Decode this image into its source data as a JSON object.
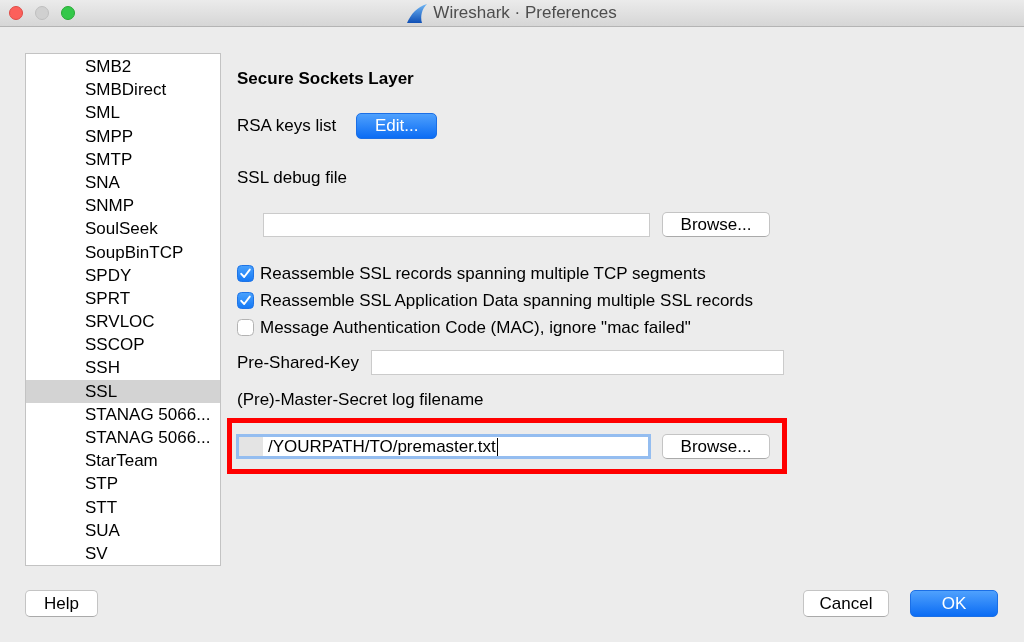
{
  "window": {
    "title": "Wireshark · Preferences",
    "controls": [
      {
        "kind": "close",
        "disabled": false
      },
      {
        "kind": "minimize",
        "disabled": true
      },
      {
        "kind": "zoom",
        "disabled": false
      }
    ]
  },
  "sidebar": {
    "items": [
      {
        "label": "SMB2",
        "selected": false
      },
      {
        "label": "SMBDirect",
        "selected": false
      },
      {
        "label": "SML",
        "selected": false
      },
      {
        "label": "SMPP",
        "selected": false
      },
      {
        "label": "SMTP",
        "selected": false
      },
      {
        "label": "SNA",
        "selected": false
      },
      {
        "label": "SNMP",
        "selected": false
      },
      {
        "label": "SoulSeek",
        "selected": false
      },
      {
        "label": "SoupBinTCP",
        "selected": false
      },
      {
        "label": "SPDY",
        "selected": false
      },
      {
        "label": "SPRT",
        "selected": false
      },
      {
        "label": "SRVLOC",
        "selected": false
      },
      {
        "label": "SSCOP",
        "selected": false
      },
      {
        "label": "SSH",
        "selected": false
      },
      {
        "label": "SSL",
        "selected": true
      },
      {
        "label": "STANAG 5066...",
        "selected": false
      },
      {
        "label": "STANAG 5066...",
        "selected": false
      },
      {
        "label": "StarTeam",
        "selected": false
      },
      {
        "label": "STP",
        "selected": false
      },
      {
        "label": "STT",
        "selected": false
      },
      {
        "label": "SUA",
        "selected": false
      },
      {
        "label": "SV",
        "selected": false
      }
    ]
  },
  "panel": {
    "heading": "Secure Sockets Layer",
    "rsa_keys": {
      "label": "RSA keys list",
      "button": {
        "label": "Edit...",
        "primary": true
      }
    },
    "debug_file": {
      "label": "SSL debug file",
      "button": {
        "label": "Browse...",
        "primary": false
      }
    },
    "options": [
      {
        "label": "Reassemble SSL records spanning multiple TCP segments",
        "checked": true
      },
      {
        "label": "Reassemble SSL Application Data spanning multiple SSL records",
        "checked": true
      },
      {
        "label": "Message Authentication Code (MAC), ignore \"mac failed\"",
        "checked": false
      }
    ],
    "pre_shared_key": {
      "label": "Pre-Shared-Key"
    },
    "master_secret_log": {
      "label": "(Pre)-Master-Secret log filename",
      "value": "/YOURPATH/TO/premaster.txt",
      "focused": true,
      "highlighted": true,
      "button": {
        "label": "Browse...",
        "primary": false
      }
    }
  },
  "footer": {
    "left_buttons": [
      {
        "label": "Help",
        "primary": false
      }
    ],
    "right_buttons": [
      {
        "label": "Cancel",
        "primary": false
      },
      {
        "label": "OK",
        "primary": true
      }
    ]
  }
}
